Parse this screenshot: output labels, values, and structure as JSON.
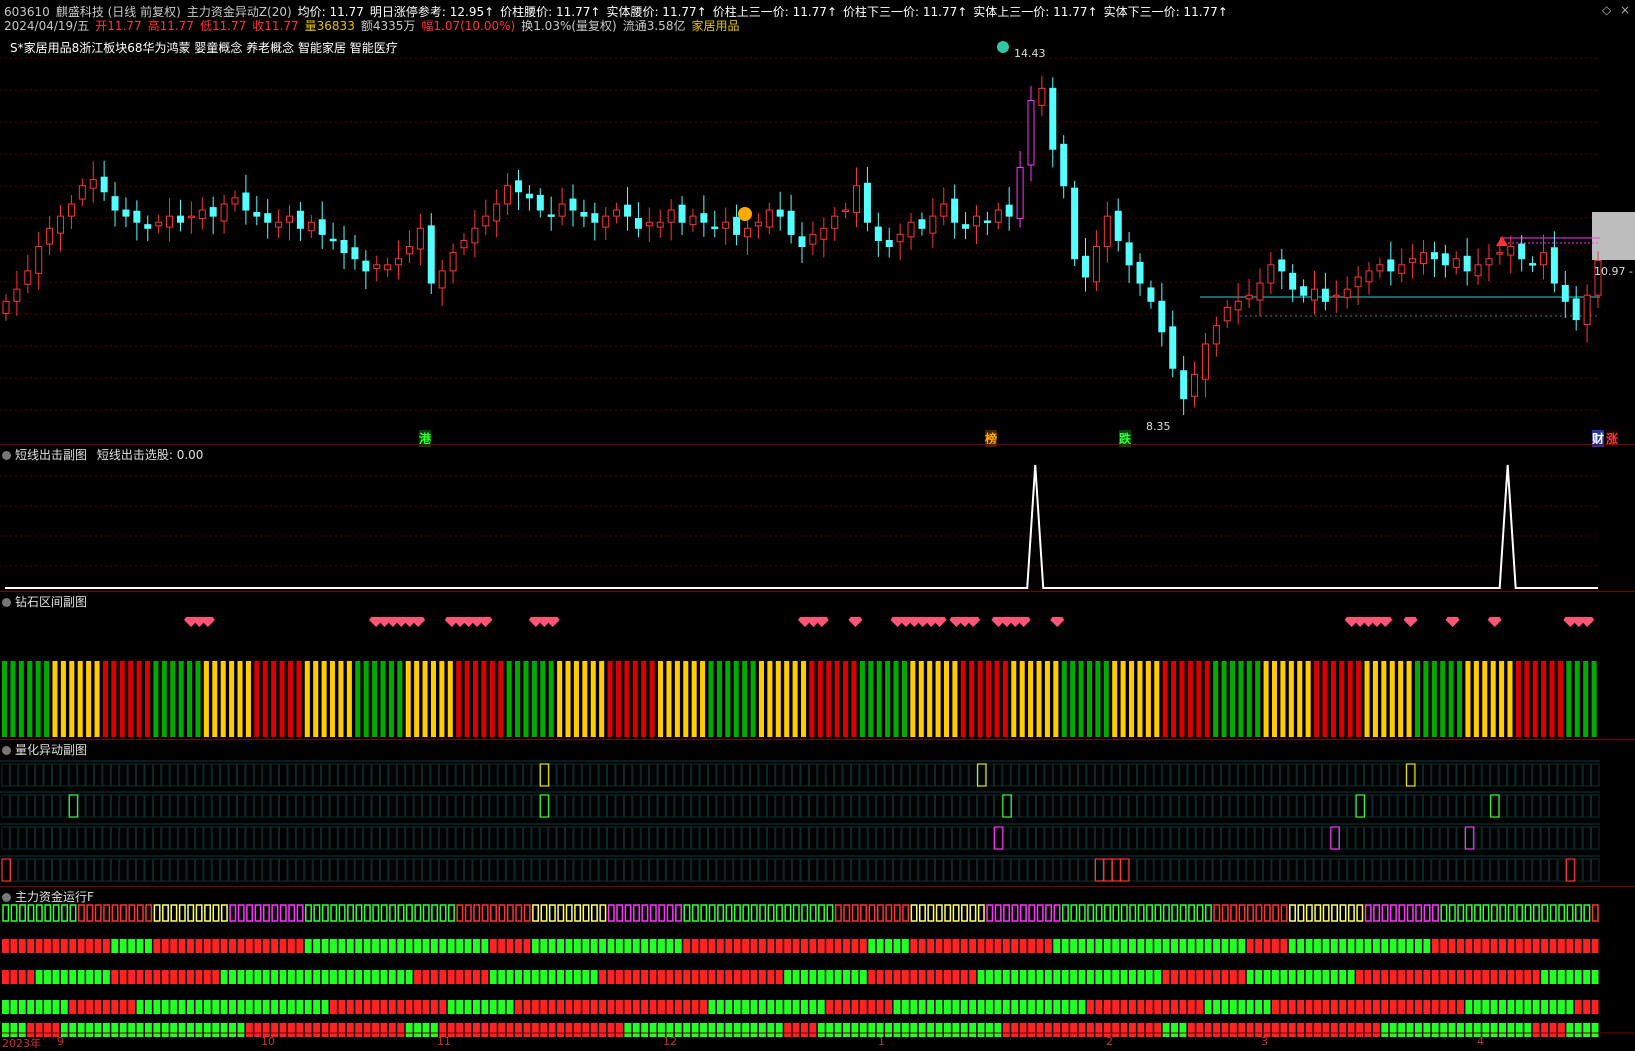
{
  "header": {
    "line1": [
      {
        "text": "603610",
        "color": "#c8c8c8"
      },
      {
        "text": "麒盛科技 (日线 前复权)",
        "color": "#c8c8c8"
      },
      {
        "text": "主力资金异动Z(20)",
        "color": "#c8c8c8"
      },
      {
        "text": "均价: 11.77",
        "color": "#ffffff"
      },
      {
        "text": "明日涨停参考: 12.95↑",
        "color": "#ffffff"
      },
      {
        "text": "价柱腰价: 11.77↑",
        "color": "#ffffff"
      },
      {
        "text": "实体腰价: 11.77↑",
        "color": "#ffffff"
      },
      {
        "text": "价柱上三一价: 11.77↑",
        "color": "#ffffff"
      },
      {
        "text": "价柱下三一价: 11.77↑",
        "color": "#ffffff"
      },
      {
        "text": "实体上三一价: 11.77↑",
        "color": "#ffffff"
      },
      {
        "text": "实体下三一价: 11.77↑",
        "color": "#ffffff"
      }
    ],
    "line2": [
      {
        "text": "2024/04/19/五",
        "color": "#c8c8c8"
      },
      {
        "text": "开11.77",
        "color": "#ff3333"
      },
      {
        "text": "高11.77",
        "color": "#ff3333"
      },
      {
        "text": "低11.77",
        "color": "#ff3333"
      },
      {
        "text": "收11.77",
        "color": "#ff3333"
      },
      {
        "text": "量36833",
        "color": "#e6c200"
      },
      {
        "text": "额4335万",
        "color": "#c8c8c8"
      },
      {
        "text": "幅1.07(10.00%)",
        "color": "#ff3333"
      },
      {
        "text": "换1.03%(量复权)",
        "color": "#c8c8c8"
      },
      {
        "text": "流通3.58亿",
        "color": "#c8c8c8"
      },
      {
        "text": "家居用品",
        "color": "#e6c200"
      }
    ],
    "line3": "S*家居用品8浙江板块68华为鸿蒙 婴童概念 养老概念 智能家居 智能医疗"
  },
  "window_controls": [
    "◇",
    "×"
  ],
  "main_chart": {
    "high_label": "14.43",
    "low_label": "8.35",
    "right_price_label": "10.97 -",
    "markers": [
      {
        "text": "港",
        "color": "#33ff33",
        "bg": "#004400"
      },
      {
        "text": "榜",
        "color": "#ffaa00",
        "bg": "#442200"
      },
      {
        "text": "跌",
        "color": "#33ff33",
        "bg": "#004400"
      },
      {
        "text": "财",
        "color": "#ffffff",
        "bg": "#2233aa"
      },
      {
        "text": "涨",
        "color": "#ff3333",
        "bg": "#220000"
      }
    ]
  },
  "panels": {
    "p1": {
      "title": "短线出击副图",
      "value_label": "短线出击选股: 0.00"
    },
    "p2": {
      "title": "钻石区间副图"
    },
    "p3": {
      "title": "量化异动副图"
    },
    "p4": {
      "title": "主力资金运行F"
    }
  },
  "x_axis_labels": [
    "2023年",
    "9",
    "10",
    "11",
    "12",
    "1",
    "2",
    "3",
    "4"
  ],
  "chart_data": {
    "type": "candlestick",
    "title": "603610 麒盛科技 日线 前复权",
    "x_range": [
      "2023年8月",
      "2024/04/19"
    ],
    "ylim": [
      8.35,
      14.43
    ],
    "price_high": 14.43,
    "price_low": 8.35,
    "last_close": 11.77,
    "right_axis_price": 10.97,
    "close_series": [
      10.3,
      10.5,
      10.8,
      11.2,
      11.5,
      11.7,
      11.9,
      12.2,
      12.3,
      12.1,
      11.8,
      11.7,
      11.6,
      11.5,
      11.6,
      11.7,
      11.6,
      11.7,
      11.8,
      11.7,
      11.9,
      12.0,
      11.8,
      11.7,
      11.6,
      11.6,
      11.7,
      11.5,
      11.6,
      11.4,
      11.3,
      11.1,
      11.0,
      10.8,
      10.9,
      10.9,
      11.0,
      11.2,
      11.5,
      10.6,
      10.8,
      11.1,
      11.3,
      11.5,
      11.7,
      11.9,
      12.2,
      12.1,
      12.0,
      11.8,
      11.7,
      11.9,
      11.8,
      11.7,
      11.6,
      11.7,
      11.8,
      11.7,
      11.5,
      11.6,
      11.6,
      11.8,
      11.6,
      11.7,
      11.6,
      11.5,
      11.6,
      11.4,
      11.5,
      11.6,
      11.8,
      11.7,
      11.4,
      11.2,
      11.4,
      11.5,
      11.7,
      11.8,
      12.2,
      11.6,
      11.3,
      11.2,
      11.4,
      11.6,
      11.5,
      11.7,
      11.9,
      11.6,
      11.5,
      11.7,
      11.6,
      11.8,
      11.7,
      12.5,
      13.6,
      13.8,
      12.8,
      12.2,
      11.0,
      10.7,
      11.2,
      11.7,
      11.3,
      10.9,
      10.6,
      10.3,
      9.8,
      9.2,
      8.7,
      9.1,
      9.6,
      9.9,
      10.2,
      10.3,
      10.4,
      10.6,
      10.9,
      10.8,
      10.5,
      10.4,
      10.5,
      10.3,
      10.4,
      10.5,
      10.7,
      10.8,
      10.9,
      10.8,
      10.9,
      11.0,
      11.1,
      11.0,
      10.9,
      11.0,
      10.8,
      10.9,
      11.0,
      11.1,
      11.2,
      11.0,
      10.9,
      11.1,
      10.6,
      10.3,
      10.0,
      10.4,
      10.97
    ]
  },
  "subchart_data": {
    "short_attack_spikes": [
      122,
      178
    ],
    "diamond_groups": [
      [
        22,
        24
      ],
      [
        44,
        49
      ],
      [
        53,
        57
      ],
      [
        63,
        65
      ],
      [
        95,
        97
      ],
      [
        101,
        101
      ],
      [
        106,
        111
      ],
      [
        113,
        115
      ],
      [
        118,
        121
      ],
      [
        125,
        125
      ],
      [
        160,
        164
      ],
      [
        167,
        167
      ],
      [
        172,
        172
      ],
      [
        177,
        177
      ],
      [
        186,
        188
      ]
    ]
  },
  "colors": {
    "up": "#ff3333",
    "down": "#54ffff",
    "grid": "#5a0000",
    "bar_red": "#d80000",
    "bar_yellow": "#ffcc00",
    "bar_green": "#00aa00",
    "magenta": "#ff33ff"
  }
}
